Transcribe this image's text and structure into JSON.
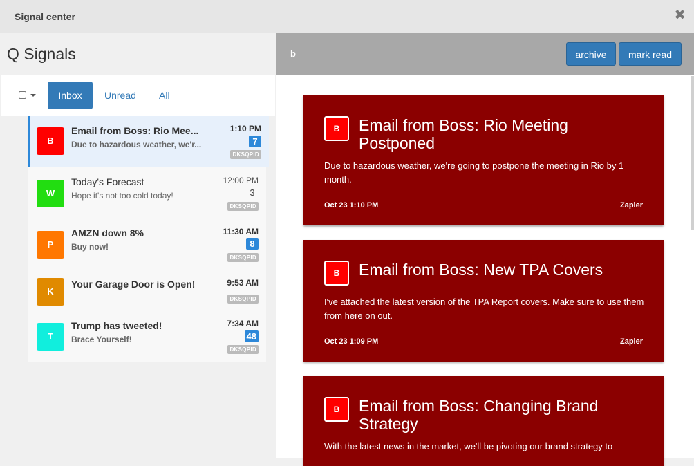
{
  "window": {
    "title": "Signal center",
    "close_glyph": "✖"
  },
  "left": {
    "heading": "Q Signals",
    "filter": {
      "inbox_label": "Inbox",
      "unread_label": "Unread",
      "all_label": "All"
    },
    "items": [
      {
        "avatar": "B",
        "avatar_color": "#ff0000",
        "title": "Email from Boss: Rio Mee...",
        "subtitle": "Due to hazardous weather, we'r...",
        "time": "1:10 PM",
        "count": "7",
        "tag": "DKSQPID",
        "unread": true,
        "active": true
      },
      {
        "avatar": "W",
        "avatar_color": "#22dd11",
        "title": "Today's Forecast",
        "subtitle": "Hope it's not too cold today!",
        "time": "12:00 PM",
        "count": "3",
        "tag": "DKSQPID",
        "unread": false,
        "active": false
      },
      {
        "avatar": "P",
        "avatar_color": "#ff7700",
        "title": "AMZN down 8%",
        "subtitle": "Buy now!",
        "time": "11:30 AM",
        "count": "8",
        "tag": "DKSQPID",
        "unread": true,
        "active": false
      },
      {
        "avatar": "K",
        "avatar_color": "#e08a00",
        "title": "Your Garage Door is Open!",
        "subtitle": "",
        "time": "9:53 AM",
        "count": "",
        "tag": "DKSQPID",
        "unread": true,
        "active": false
      },
      {
        "avatar": "T",
        "avatar_color": "#11eedd",
        "title": "Trump has tweeted!",
        "subtitle": "Brace Yourself!",
        "time": "7:34 AM",
        "count": "48",
        "tag": "DKSQPID",
        "unread": true,
        "active": false
      }
    ]
  },
  "right": {
    "selected_label": "b",
    "archive_label": "archive",
    "mark_read_label": "mark read",
    "cards": [
      {
        "icon": "B",
        "title": "Email from Boss: Rio Meeting Postponed",
        "body": "Due to hazardous weather, we're going to postpone the meeting in Rio by 1 month.",
        "date": "Oct 23 1:10 PM",
        "source": "Zapier"
      },
      {
        "icon": "B",
        "title": "Email from Boss: New TPA Covers",
        "body": "I've attached the latest version of the TPA Report covers. Make sure to use them from here on out.",
        "date": "Oct 23 1:09 PM",
        "source": "Zapier"
      },
      {
        "icon": "B",
        "title": "Email from Boss: Changing Brand Strategy",
        "body": "With the latest news in the market, we'll be pivoting our brand strategy to",
        "date": "",
        "source": ""
      }
    ]
  }
}
